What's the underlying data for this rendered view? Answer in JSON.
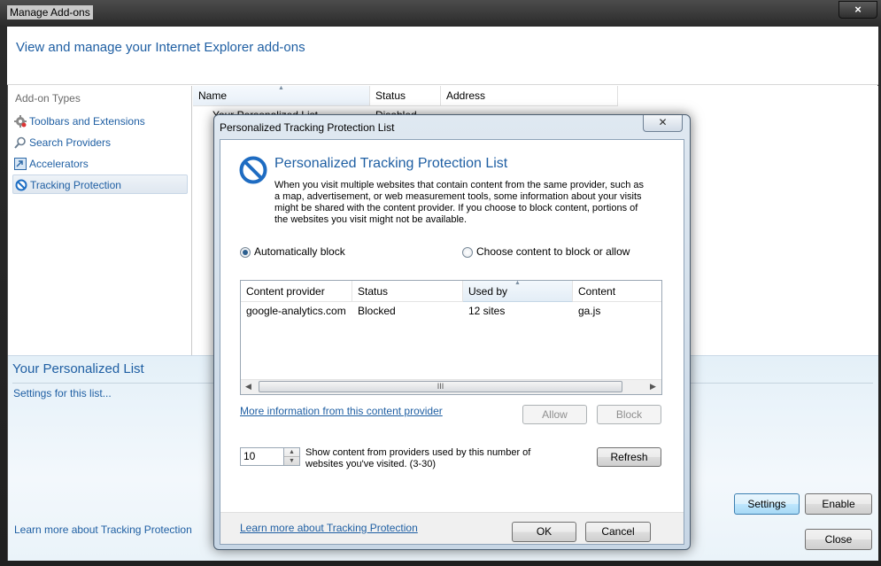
{
  "window": {
    "title": "Manage Add-ons",
    "close_glyph": "×"
  },
  "header": {
    "text": "View and manage your Internet Explorer add-ons"
  },
  "addon_types": {
    "heading": "Add-on Types",
    "items": [
      {
        "label": "Toolbars and Extensions",
        "icon": "gear-icon"
      },
      {
        "label": "Search Providers",
        "icon": "search-icon"
      },
      {
        "label": "Accelerators",
        "icon": "accelerator-icon"
      },
      {
        "label": "Tracking Protection",
        "icon": "no-entry-icon",
        "selected": true
      }
    ]
  },
  "list": {
    "columns": [
      "Name",
      "Status",
      "Address"
    ],
    "sorted_column": "Name",
    "rows": [
      {
        "name": "Your Personalized List",
        "status": "Disabled",
        "address": ""
      }
    ]
  },
  "details": {
    "title": "Your Personalized List",
    "settings_link": "Settings for this list...",
    "learn_more_link": "Learn more about Tracking Protection",
    "buttons": {
      "settings": "Settings",
      "enable": "Enable",
      "close": "Close"
    }
  },
  "dialog": {
    "title": "Personalized Tracking Protection List",
    "close_glyph": "✕",
    "heading": "Personalized Tracking Protection List",
    "description": "When you visit multiple websites that contain content from the same provider, such as a map, advertisement, or web measurement tools, some information about your visits might be shared with the content provider.  If you choose to block content, portions of the websites you visit might not be available.",
    "radios": [
      {
        "label": "Automatically block",
        "checked": true
      },
      {
        "label": "Choose content to block or allow",
        "checked": false
      }
    ],
    "grid": {
      "columns": [
        "Content provider",
        "Status",
        "Used by",
        "Content"
      ],
      "sorted_column": "Used by",
      "rows": [
        {
          "provider": "google-analytics.com",
          "status": "Blocked",
          "used_by": "12 sites",
          "content": "ga.js"
        }
      ],
      "scroll_grip": "III"
    },
    "more_info_link": "More information from this content provider",
    "allow_button": "Allow",
    "block_button": "Block",
    "threshold": {
      "value": "10",
      "description": "Show content from providers used by this number of websites you've visited. (3-30)"
    },
    "refresh_button": "Refresh",
    "learn_more_link": "Learn more about Tracking Protection",
    "ok_button": "OK",
    "cancel_button": "Cancel"
  }
}
